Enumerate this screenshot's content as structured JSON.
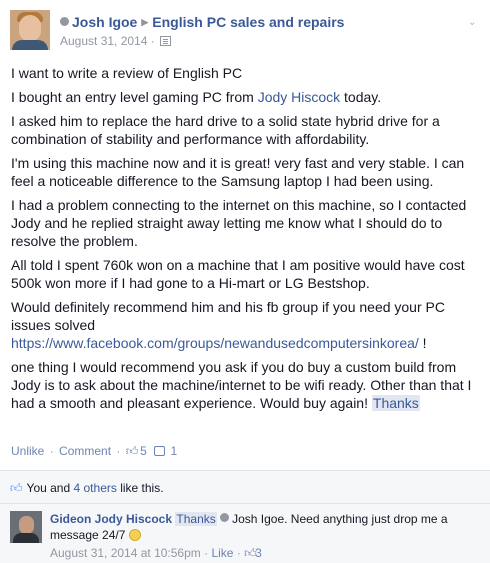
{
  "post": {
    "author": "Josh Igoe",
    "group": "English PC sales and repairs",
    "date": "August 31, 2014",
    "paragraphs": [
      "I want to write a review of English PC",
      "I asked him to replace the hard drive to a solid state hybrid drive for a combination of stability and performance with affordability.",
      "I'm using this machine now and it is great! very fast and very stable. I can feel a noticeable difference to the Samsung laptop I had been using.",
      "I had a problem connecting to the internet on this machine, so I contacted Jody and he replied straight away letting me know what I should do to resolve the problem.",
      "All told I spent 760k won on a machine that I am positive would have cost 500k won more if I had gone to a Hi-mart or LG Bestshop."
    ],
    "p2_before": "I bought an entry level gaming PC from ",
    "p2_link": "Jody Hiscock",
    "p2_after": " today.",
    "p7_text": "Would definitely recommend him and his fb group if you need your PC issues solved",
    "p7_link": "https://www.facebook.com/groups/newandusedcomputersinkorea/",
    "p7_after": " !",
    "p8_text": "one thing I would recommend you ask if you do buy a custom build from Jody is to ask about the machine/internet to be wifi ready. Other than that I had a smooth and pleasant experience. Would buy again! ",
    "p8_tag": "Thanks"
  },
  "actions": {
    "unlike": "Unlike",
    "comment": "Comment",
    "sep": "·",
    "like_count": "5",
    "comment_count": "1"
  },
  "likes": {
    "prefix": "You and ",
    "others": "4 others",
    "suffix": " like this."
  },
  "comment": {
    "name": "Gideon Jody Hiscock",
    "tag1": "Thanks",
    "tag2": "Josh Igoe",
    "text": ". Need anything just drop me a message 24/7 ",
    "time": "August 31, 2014 at 10:56pm",
    "like": "Like",
    "like_count": "3",
    "sep": "·"
  },
  "icons": {
    "author_dot": "online-dot-icon",
    "arrow": "right-triangle-icon",
    "privacy": "group-privacy-icon",
    "options": "chevron-down-icon"
  },
  "colors": {
    "link": "#3b5998",
    "meta": "#9197a3",
    "ufi_bg": "#f6f7f8"
  }
}
